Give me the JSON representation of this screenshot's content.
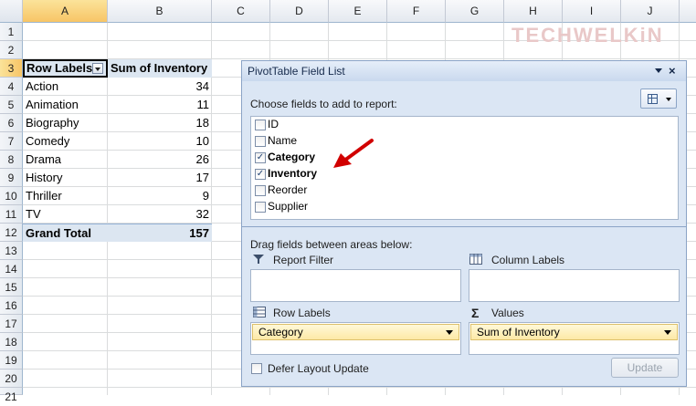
{
  "columns": [
    "A",
    "B",
    "C",
    "D",
    "E",
    "F",
    "G",
    "H",
    "I",
    "J"
  ],
  "rows": [
    "1",
    "2",
    "3",
    "4",
    "5",
    "6",
    "7",
    "8",
    "9",
    "10",
    "11",
    "12",
    "13",
    "14",
    "15",
    "16",
    "17",
    "18",
    "19",
    "20",
    "21"
  ],
  "pivot": {
    "header_label": "Row Labels",
    "header_value": "Sum of Inventory",
    "items": [
      {
        "label": "Action",
        "value": "34"
      },
      {
        "label": "Animation",
        "value": "11"
      },
      {
        "label": "Biography",
        "value": "18"
      },
      {
        "label": "Comedy",
        "value": "10"
      },
      {
        "label": "Drama",
        "value": "26"
      },
      {
        "label": "History",
        "value": "17"
      },
      {
        "label": "Thriller",
        "value": "9"
      },
      {
        "label": "TV",
        "value": "32"
      }
    ],
    "total_label": "Grand Total",
    "total_value": "157"
  },
  "watermark": {
    "text": "TECHWELKiN"
  },
  "pane": {
    "title": "PivotTable Field List",
    "choose_label": "Choose fields to add to report:",
    "fields": [
      {
        "name": "ID",
        "checked": false
      },
      {
        "name": "Name",
        "checked": false
      },
      {
        "name": "Category",
        "checked": true
      },
      {
        "name": "Inventory",
        "checked": true
      },
      {
        "name": "Reorder",
        "checked": false
      },
      {
        "name": "Supplier",
        "checked": false
      }
    ],
    "drag_label": "Drag fields between areas below:",
    "report_filter": "Report Filter",
    "column_labels": "Column Labels",
    "row_labels": "Row Labels",
    "values": "Values",
    "row_item": "Category",
    "value_item": "Sum of Inventory",
    "defer_label": "Defer Layout Update",
    "update_label": "Update"
  },
  "colors": {
    "accent": "#dce6f1",
    "arrow": "#d10000"
  }
}
